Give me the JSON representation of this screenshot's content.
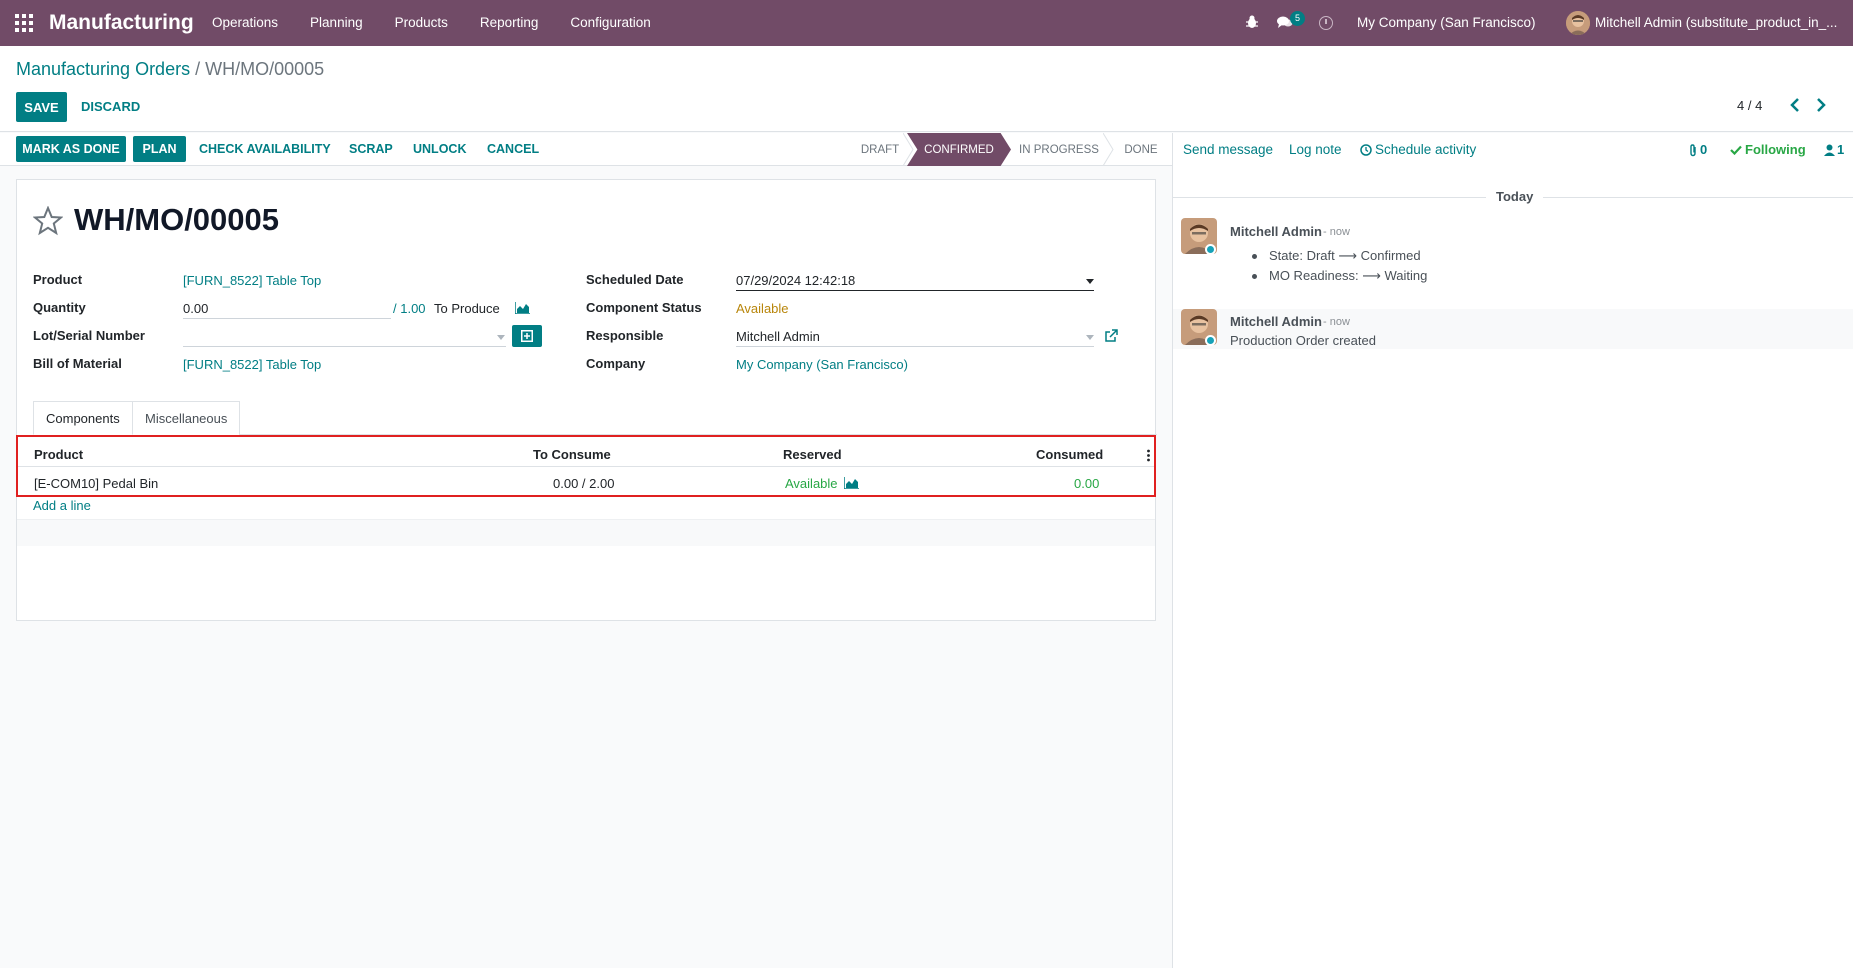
{
  "navbar": {
    "app_name": "Manufacturing",
    "menu": [
      "Operations",
      "Planning",
      "Products",
      "Reporting",
      "Configuration"
    ],
    "chat_count": "5",
    "company": "My Company (San Francisco)",
    "user": "Mitchell Admin (substitute_product_in_..."
  },
  "breadcrumb": {
    "parent": "Manufacturing Orders",
    "separator": "/",
    "current": "WH/MO/00005"
  },
  "controls": {
    "save": "SAVE",
    "discard": "DISCARD",
    "pager": "4 / 4"
  },
  "statusbar": {
    "buttons": [
      "MARK AS DONE",
      "PLAN",
      "CHECK AVAILABILITY",
      "SCRAP",
      "UNLOCK",
      "CANCEL"
    ],
    "stages": [
      "DRAFT",
      "CONFIRMED",
      "IN PROGRESS",
      "DONE"
    ],
    "active_stage": "CONFIRMED"
  },
  "form": {
    "title": "WH/MO/00005",
    "product_label": "Product",
    "product_value": "[FURN_8522] Table Top",
    "quantity_label": "Quantity",
    "quantity_value": "0.00",
    "quantity_total": "/ 1.00",
    "to_produce": "To Produce",
    "lot_label": "Lot/Serial Number",
    "lot_value": "",
    "bom_label": "Bill of Material",
    "bom_value": "[FURN_8522] Table Top",
    "scheduled_label": "Scheduled Date",
    "scheduled_value": "07/29/2024 12:42:18",
    "component_status_label": "Component Status",
    "component_status_value": "Available",
    "responsible_label": "Responsible",
    "responsible_value": "Mitchell Admin",
    "company_label": "Company",
    "company_value": "My Company (San Francisco)"
  },
  "tabs": [
    "Components",
    "Miscellaneous"
  ],
  "table": {
    "headers": [
      "Product",
      "To Consume",
      "Reserved",
      "Consumed"
    ],
    "rows": [
      {
        "product": "[E-COM10] Pedal Bin",
        "to_consume": "0.00 / 2.00",
        "reserved": "Available",
        "consumed": "0.00"
      }
    ],
    "add_line": "Add a line"
  },
  "chatter": {
    "send_message": "Send message",
    "log_note": "Log note",
    "schedule_activity": "Schedule activity",
    "attachments": "0",
    "following": "Following",
    "followers": "1",
    "today": "Today",
    "messages": [
      {
        "author": "Mitchell Admin",
        "date": "- now",
        "lines": [
          "State: Draft ⟶ Confirmed",
          "MO Readiness: ⟶ Waiting"
        ]
      },
      {
        "author": "Mitchell Admin",
        "date": "- now",
        "lines": [
          "Production Order created"
        ]
      }
    ]
  },
  "colors": {
    "brand": "#714b67",
    "accent": "#017e84",
    "available": "#28a745",
    "status_warning": "#b8860b",
    "highlight_box": "#e02020"
  }
}
